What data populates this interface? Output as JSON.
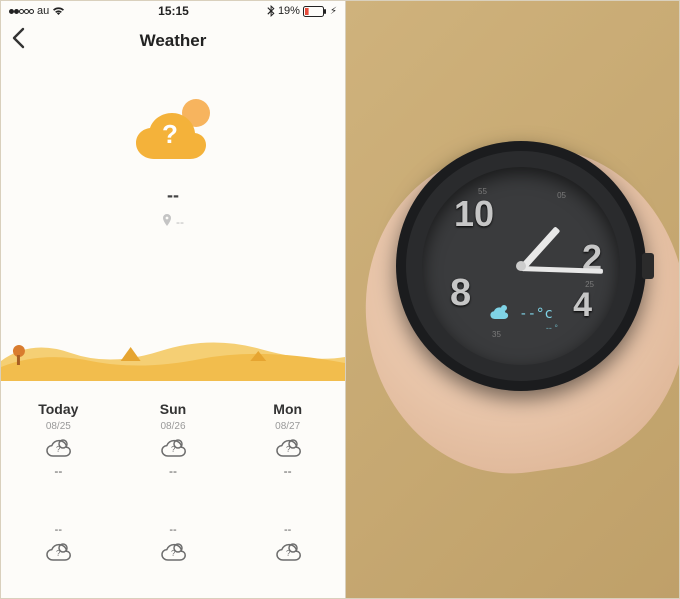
{
  "status": {
    "carrier": "au",
    "time": "15:15",
    "battery_pct": "19%"
  },
  "nav": {
    "title": "Weather"
  },
  "hero": {
    "temp": "--",
    "location": "--"
  },
  "forecast": [
    {
      "label": "Today",
      "date": "08/25",
      "value": "--"
    },
    {
      "label": "Sun",
      "date": "08/26",
      "value": "--"
    },
    {
      "label": "Mon",
      "date": "08/27",
      "value": "--"
    }
  ],
  "forecast2": [
    {
      "value": "--"
    },
    {
      "value": "--"
    },
    {
      "value": "--"
    }
  ],
  "watch": {
    "numerals": {
      "n10": "10",
      "n2": "2",
      "n4": "4",
      "n8": "8"
    },
    "minute_marks": {
      "t05": "05",
      "t55": "55",
      "t25": "25",
      "t35": "35"
    },
    "oled_temp": "--°c",
    "oled_sub": "-- °"
  }
}
